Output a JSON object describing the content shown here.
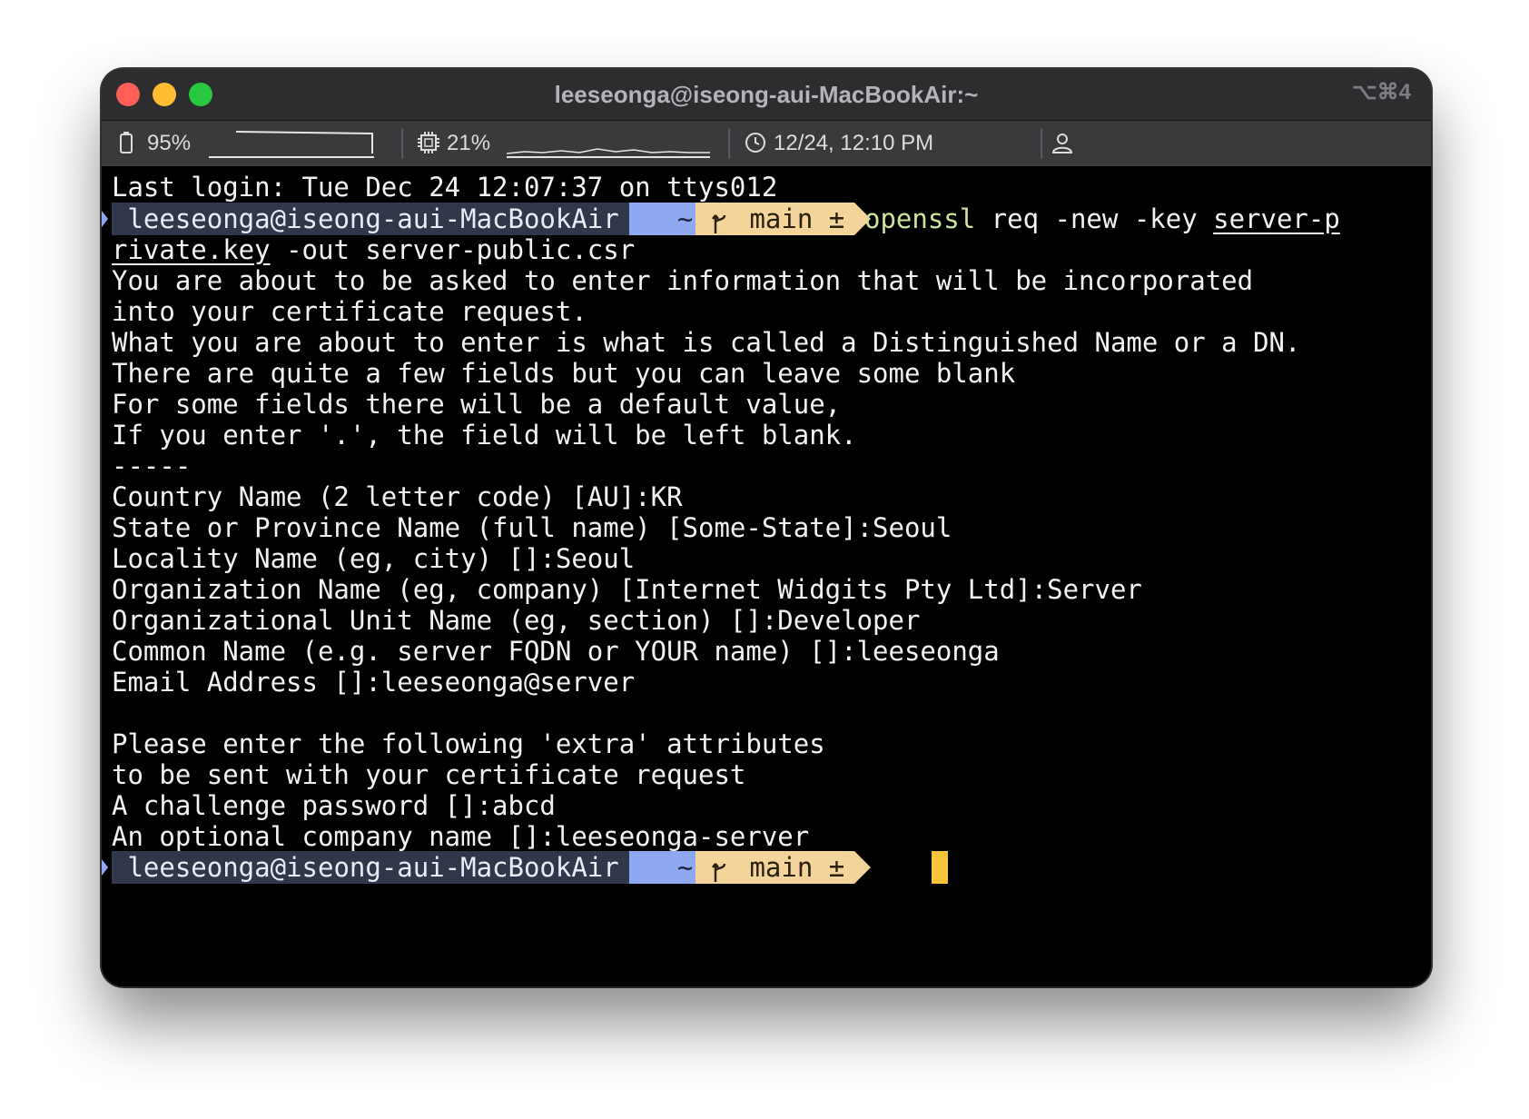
{
  "window": {
    "title": "leeseonga@iseong-aui-MacBookAir:~",
    "shortcut": "⌥⌘4"
  },
  "statusbar": {
    "battery": "95%",
    "cpu": "21%",
    "datetime": "12/24, 12:10 PM",
    "battery_icon": "battery-icon",
    "cpu_icon": "cpu-icon",
    "clock_icon": "clock-icon",
    "user_icon": "user-icon"
  },
  "prompt": {
    "user_host": "leeseonga@iseong-aui-MacBookAir",
    "dir": "~",
    "branch": "main",
    "dirty_mark": "±",
    "colors": {
      "user_bg": "#30374a",
      "dir_bg": "#8fa8f2",
      "git_bg": "#f3d49b",
      "command": "#cde59a",
      "cursor": "#f4c43a"
    }
  },
  "terminal": {
    "last_login": "Last login: Tue Dec 24 12:07:37 on ttys012",
    "command": {
      "name": "openssl",
      "args": " req -new -key ",
      "key_file_part1": "server-p",
      "key_file_part2": "rivate.key",
      "rest": " -out server-public.csr"
    },
    "output": [
      "You are about to be asked to enter information that will be incorporated",
      "into your certificate request.",
      "What you are about to enter is what is called a Distinguished Name or a DN.",
      "There are quite a few fields but you can leave some blank",
      "For some fields there will be a default value,",
      "If you enter '.', the field will be left blank.",
      "-----",
      "Country Name (2 letter code) [AU]:KR",
      "State or Province Name (full name) [Some-State]:Seoul",
      "Locality Name (eg, city) []:Seoul",
      "Organization Name (eg, company) [Internet Widgits Pty Ltd]:Server",
      "Organizational Unit Name (eg, section) []:Developer",
      "Common Name (e.g. server FQDN or YOUR name) []:leeseonga",
      "Email Address []:leeseonga@server",
      "",
      "Please enter the following 'extra' attributes",
      "to be sent with your certificate request",
      "A challenge password []:abcd",
      "An optional company name []:leeseonga-server"
    ]
  }
}
